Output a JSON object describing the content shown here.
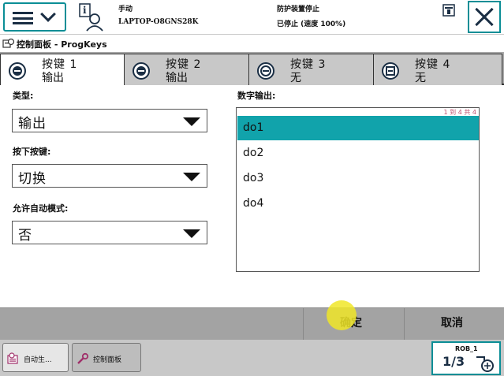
{
  "topbar": {
    "mode": "手动",
    "controller": "LAPTOP-O8GNS28K",
    "status": "防护装置停止",
    "speed_status": "已停止 (速度 100%)"
  },
  "titlebar": {
    "title": "控制面板 - ProgKeys"
  },
  "tabs": [
    {
      "label": "按键 1",
      "value": "输出"
    },
    {
      "label": "按键 2",
      "value": "输出"
    },
    {
      "label": "按键 3",
      "value": "无"
    },
    {
      "label": "按键 4",
      "value": "无"
    }
  ],
  "form": {
    "type_label": "类型:",
    "type_value": "输出",
    "press_label": "按下按键:",
    "press_value": "切换",
    "auto_label": "允许自动模式:",
    "auto_value": "否"
  },
  "digital_output": {
    "label": "数字输出:",
    "count": "1 到 4 共 4",
    "items": [
      "do1",
      "do2",
      "do3",
      "do4"
    ],
    "selected": "do1"
  },
  "actions": {
    "ok": "确定",
    "cancel": "取消"
  },
  "taskbar": {
    "items": [
      "自动生...",
      "控制面板"
    ],
    "rob_label": "ROB_1",
    "rob_fraction": "1/3"
  },
  "colors": {
    "accent": "#0b8e96",
    "selected": "#11a3ab"
  }
}
